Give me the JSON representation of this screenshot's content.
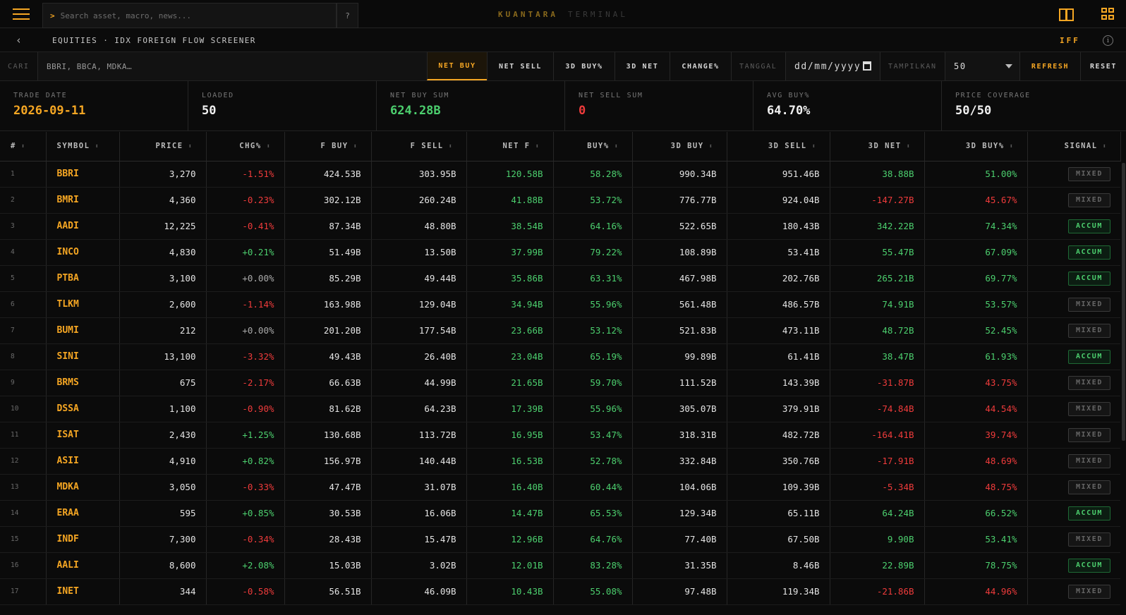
{
  "app": {
    "brand_primary": "KUANTARA",
    "brand_secondary": "TERMINAL"
  },
  "search": {
    "prompt": ">",
    "placeholder": "Search asset, macro, news...",
    "help": "?"
  },
  "crumb": {
    "text": "EQUITIES · IDX FOREIGN FLOW SCREENER",
    "code": "IFF",
    "info": "i"
  },
  "filter": {
    "cari_label": "CARI",
    "cari_placeholder": "BBRI, BBCA, MDKA…",
    "tabs": [
      "NET BUY",
      "NET SELL",
      "3D BUY%",
      "3D NET",
      "CHANGE%"
    ],
    "active_tab": "NET BUY",
    "tanggal_label": "TANGGAL",
    "date_value": "dd/mm/yyyy",
    "tampilkan_label": "TAMPILKAN",
    "tampilkan_value": "50",
    "refresh": "REFRESH",
    "reset": "RESET"
  },
  "stats": [
    {
      "label": "TRADE DATE",
      "value": "2026-09-11",
      "tone": "amber"
    },
    {
      "label": "LOADED",
      "value": "50",
      "tone": ""
    },
    {
      "label": "NET BUY SUM",
      "value": "624.28B",
      "tone": "green"
    },
    {
      "label": "NET SELL SUM",
      "value": "0",
      "tone": "red"
    },
    {
      "label": "AVG BUY%",
      "value": "64.70%",
      "tone": ""
    },
    {
      "label": "PRICE COVERAGE",
      "value": "50/50",
      "tone": ""
    }
  ],
  "table": {
    "columns": [
      "#",
      "SYMBOL",
      "PRICE",
      "CHG%",
      "F BUY",
      "F SELL",
      "NET F",
      "BUY%",
      "3D BUY",
      "3D SELL",
      "3D NET",
      "3D BUY%",
      "SIGNAL"
    ],
    "rows": [
      [
        "1",
        "BBRI",
        "3,270",
        "-1.51%",
        "424.53B",
        "303.95B",
        "120.58B",
        "58.28%",
        "990.34B",
        "951.46B",
        "38.88B",
        "51.00%",
        "MIXED"
      ],
      [
        "2",
        "BMRI",
        "4,360",
        "-0.23%",
        "302.12B",
        "260.24B",
        "41.88B",
        "53.72%",
        "776.77B",
        "924.04B",
        "-147.27B",
        "45.67%",
        "MIXED"
      ],
      [
        "3",
        "AADI",
        "12,225",
        "-0.41%",
        "87.34B",
        "48.80B",
        "38.54B",
        "64.16%",
        "522.65B",
        "180.43B",
        "342.22B",
        "74.34%",
        "ACCUM"
      ],
      [
        "4",
        "INCO",
        "4,830",
        "+0.21%",
        "51.49B",
        "13.50B",
        "37.99B",
        "79.22%",
        "108.89B",
        "53.41B",
        "55.47B",
        "67.09%",
        "ACCUM"
      ],
      [
        "5",
        "PTBA",
        "3,100",
        "+0.00%",
        "85.29B",
        "49.44B",
        "35.86B",
        "63.31%",
        "467.98B",
        "202.76B",
        "265.21B",
        "69.77%",
        "ACCUM"
      ],
      [
        "6",
        "TLKM",
        "2,600",
        "-1.14%",
        "163.98B",
        "129.04B",
        "34.94B",
        "55.96%",
        "561.48B",
        "486.57B",
        "74.91B",
        "53.57%",
        "MIXED"
      ],
      [
        "7",
        "BUMI",
        "212",
        "+0.00%",
        "201.20B",
        "177.54B",
        "23.66B",
        "53.12%",
        "521.83B",
        "473.11B",
        "48.72B",
        "52.45%",
        "MIXED"
      ],
      [
        "8",
        "SINI",
        "13,100",
        "-3.32%",
        "49.43B",
        "26.40B",
        "23.04B",
        "65.19%",
        "99.89B",
        "61.41B",
        "38.47B",
        "61.93%",
        "ACCUM"
      ],
      [
        "9",
        "BRMS",
        "675",
        "-2.17%",
        "66.63B",
        "44.99B",
        "21.65B",
        "59.70%",
        "111.52B",
        "143.39B",
        "-31.87B",
        "43.75%",
        "MIXED"
      ],
      [
        "10",
        "DSSA",
        "1,100",
        "-0.90%",
        "81.62B",
        "64.23B",
        "17.39B",
        "55.96%",
        "305.07B",
        "379.91B",
        "-74.84B",
        "44.54%",
        "MIXED"
      ],
      [
        "11",
        "ISAT",
        "2,430",
        "+1.25%",
        "130.68B",
        "113.72B",
        "16.95B",
        "53.47%",
        "318.31B",
        "482.72B",
        "-164.41B",
        "39.74%",
        "MIXED"
      ],
      [
        "12",
        "ASII",
        "4,910",
        "+0.82%",
        "156.97B",
        "140.44B",
        "16.53B",
        "52.78%",
        "332.84B",
        "350.76B",
        "-17.91B",
        "48.69%",
        "MIXED"
      ],
      [
        "13",
        "MDKA",
        "3,050",
        "-0.33%",
        "47.47B",
        "31.07B",
        "16.40B",
        "60.44%",
        "104.06B",
        "109.39B",
        "-5.34B",
        "48.75%",
        "MIXED"
      ],
      [
        "14",
        "ERAA",
        "595",
        "+0.85%",
        "30.53B",
        "16.06B",
        "14.47B",
        "65.53%",
        "129.34B",
        "65.11B",
        "64.24B",
        "66.52%",
        "ACCUM"
      ],
      [
        "15",
        "INDF",
        "7,300",
        "-0.34%",
        "28.43B",
        "15.47B",
        "12.96B",
        "64.76%",
        "77.40B",
        "67.50B",
        "9.90B",
        "53.41%",
        "MIXED"
      ],
      [
        "16",
        "AALI",
        "8,600",
        "+2.08%",
        "15.03B",
        "3.02B",
        "12.01B",
        "83.28%",
        "31.35B",
        "8.46B",
        "22.89B",
        "78.75%",
        "ACCUM"
      ],
      [
        "17",
        "INET",
        "344",
        "-0.58%",
        "56.51B",
        "46.09B",
        "10.43B",
        "55.08%",
        "97.48B",
        "119.34B",
        "-21.86B",
        "44.96%",
        "MIXED"
      ]
    ]
  },
  "colors": {
    "accent": "#f5a623",
    "positive": "#4ccf6e",
    "negative": "#ef3b3b",
    "background": "#0b0b0b"
  }
}
